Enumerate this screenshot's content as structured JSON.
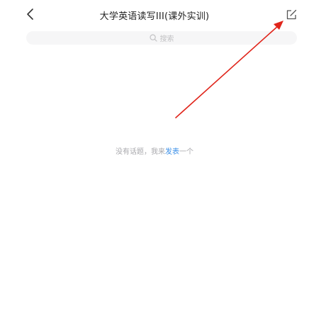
{
  "header": {
    "title": "大学英语读写III(课外实训)",
    "back_icon": "chevron-left-icon",
    "edit_icon": "compose-icon"
  },
  "search": {
    "placeholder": "搜索",
    "icon": "search-icon"
  },
  "empty_state": {
    "text_before": "没有话题，我来",
    "link_label": "发表",
    "text_after": "一个"
  },
  "colors": {
    "accent": "#3a8fe8",
    "annotation_arrow": "#e0251b"
  }
}
